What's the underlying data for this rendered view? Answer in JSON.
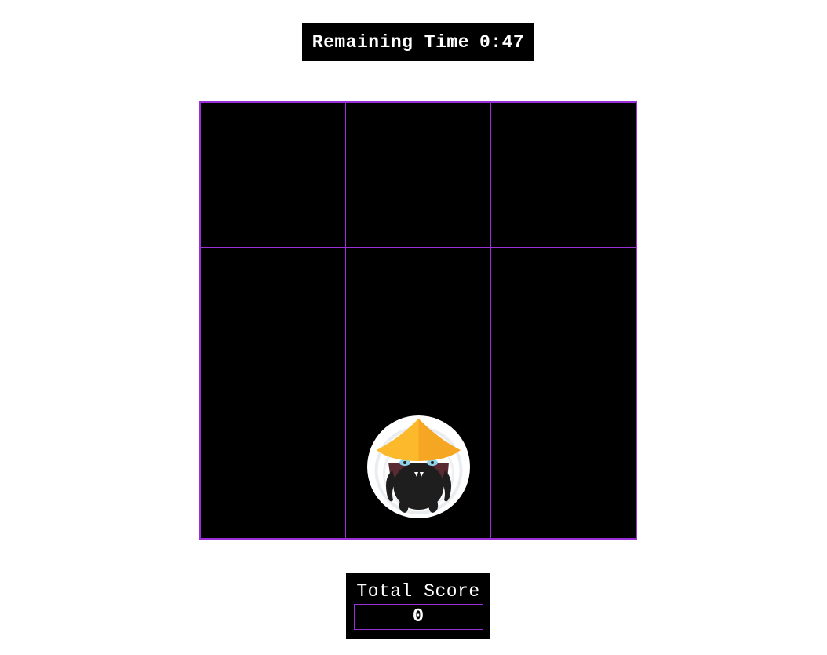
{
  "timer": {
    "label": "Remaining Time",
    "value": "0:47"
  },
  "board": {
    "rows": 3,
    "cols": 3,
    "mole_cell_index": 7,
    "mole_icon": "ninja-mole-icon"
  },
  "score": {
    "label": "Total Score",
    "value": "0"
  },
  "colors": {
    "grid_line": "#9b30d9",
    "cell_background": "#000000",
    "page_background": "#ffffff",
    "hat": "#f5a623"
  }
}
